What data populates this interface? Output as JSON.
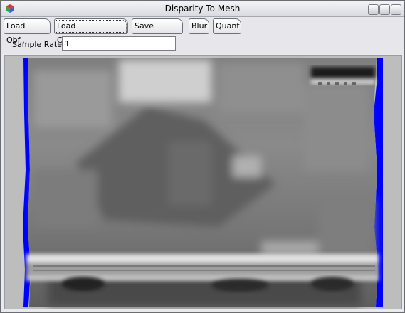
{
  "window": {
    "title": "Disparity To Mesh",
    "icon": "cube-app-icon"
  },
  "toolbar": {
    "buttons": [
      {
        "label": "Load Obf..."
      },
      {
        "label": "Load Calibration..."
      },
      {
        "label": "Save Mesh..."
      },
      {
        "label": "Blur"
      },
      {
        "label": "Quant"
      }
    ],
    "sample_rate_label": "Sample Rate:",
    "sample_rate_value": "1"
  },
  "viewport": {
    "content": "disparity-depth-image",
    "border_color": "#0000ff"
  }
}
